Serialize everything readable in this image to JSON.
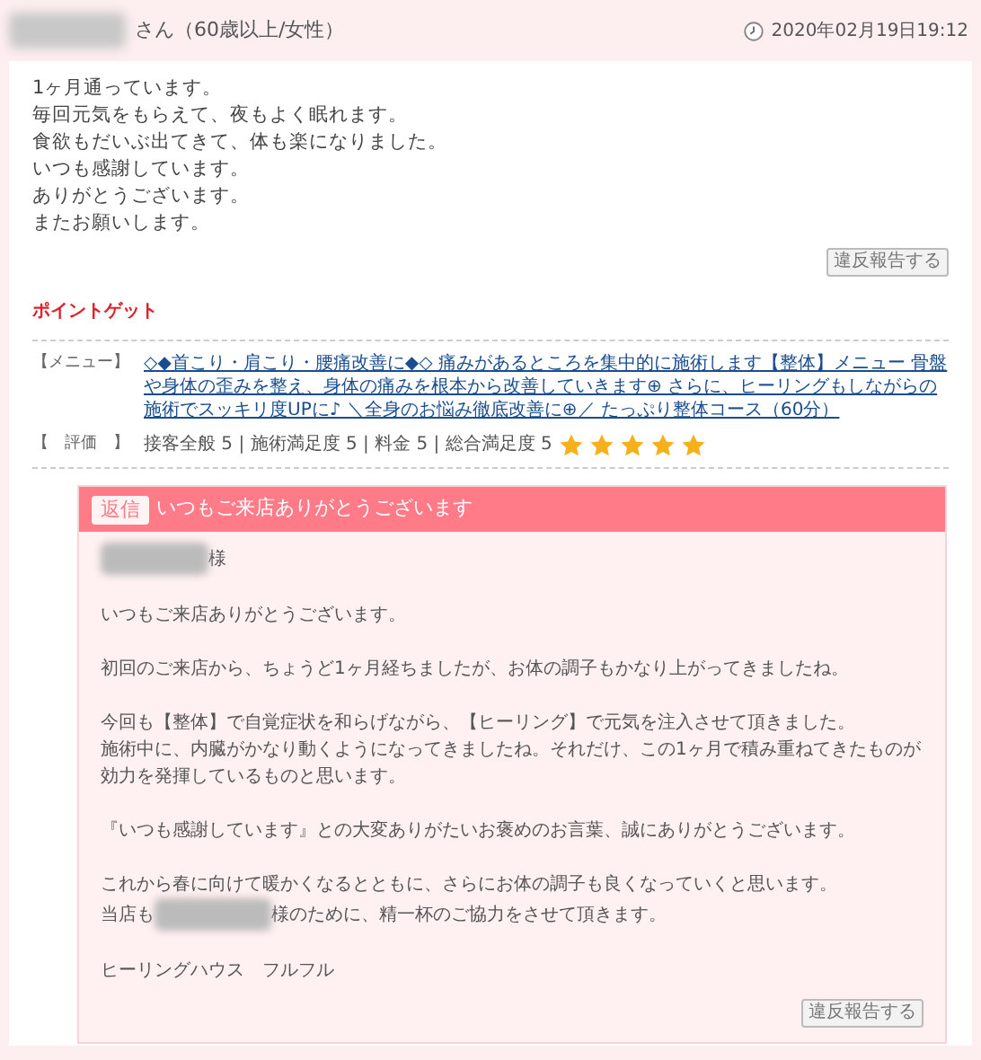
{
  "header": {
    "reviewer_suffix": "さん（60歳以上/女性）",
    "date": "2020年02月19日19:12"
  },
  "review": {
    "lines": [
      "1ヶ月通っています。",
      "毎回元気をもらえて、夜もよく眠れます。",
      "食欲もだいぶ出てきて、体も楽になりました。",
      "いつも感謝しています。",
      "ありがとうございます。",
      "またお願いします。"
    ],
    "report_button": "違反報告する"
  },
  "points_label": "ポイントゲット",
  "menu": {
    "label": "【メニュー】",
    "link": "◇◆首こり・肩こり・腰痛改善に◆◇ 痛みがあるところを集中的に施術します【整体】メニュー 骨盤や身体の歪みを整え、身体の痛みを根本から改善していきます⊕ さらに、ヒーリングもしながらの施術でスッキリ度UPに♪ ＼全身のお悩み徹底改善に⊕／ たっぷり整体コース（60分）"
  },
  "rating": {
    "label": "【　評価　】",
    "scores": "接客全般 5 | 施術満足度 5 | 料金 5 | 総合満足度 5",
    "stars": 5
  },
  "reply": {
    "badge": "返信",
    "title": "いつもご来店ありがとうございます",
    "salutation": "様",
    "paragraphs": [
      {
        "lines": [
          {
            "kind": "plain",
            "text": "いつもご来店ありがとうございます。"
          }
        ]
      },
      {
        "lines": [
          {
            "kind": "plain",
            "text": "初回のご来店から、ちょうど1ヶ月経ちましたが、お体の調子もかなり上がってきましたね。"
          }
        ]
      },
      {
        "lines": [
          {
            "kind": "plain",
            "text": "今回も【整体】で自覚症状を和らげながら、【ヒーリング】で元気を注入させて頂きました。"
          },
          {
            "kind": "plain",
            "text": "施術中に、内臓がかなり動くようになってきましたね。それだけ、この1ヶ月で積み重ねてきたものが効力を発揮しているものと思います。"
          }
        ]
      },
      {
        "lines": [
          {
            "kind": "plain",
            "text": "『いつも感謝しています』との大変ありがたいお褒めのお言葉、誠にありがとうございます。"
          }
        ]
      },
      {
        "lines": [
          {
            "kind": "plain",
            "text": "これから春に向けて暖かくなるとともに、さらにお体の調子も良くなっていくと思います。"
          },
          {
            "kind": "with_name",
            "before": "当店も",
            "after": "様のために、精一杯のご協力をさせて頂きます。"
          }
        ]
      },
      {
        "lines": [
          {
            "kind": "plain",
            "text": "ヒーリングハウス　フルフル"
          }
        ]
      }
    ],
    "report_button": "違反報告する"
  }
}
